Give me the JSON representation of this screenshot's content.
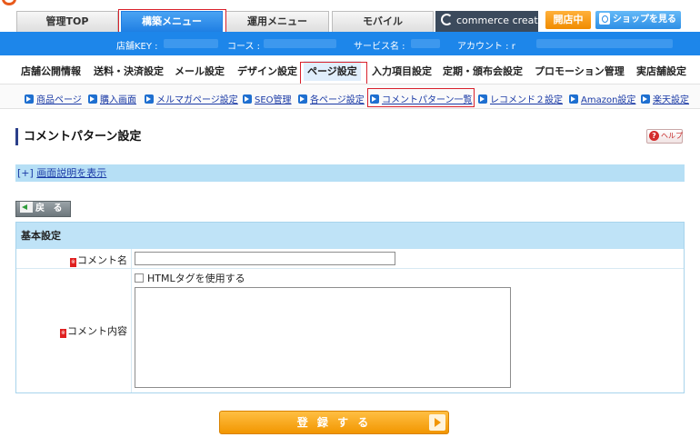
{
  "main_tabs": [
    {
      "label": "管理TOP"
    },
    {
      "label": "構築メニュー"
    },
    {
      "label": "運用メニュー"
    },
    {
      "label": "モバイル"
    }
  ],
  "header_buttons": {
    "commerce_creator": "commerce creator",
    "store_open": "開店中",
    "view_shop": "ショップを見る"
  },
  "info_bar": {
    "store_key_label": "店舗KEY :",
    "course_label": "コース :",
    "service_name_label": "サービス名 :",
    "account_label": "アカウント : r"
  },
  "sub_nav": [
    {
      "label": "店舗公開情報"
    },
    {
      "label": "送料・決済設定"
    },
    {
      "label": "メール設定"
    },
    {
      "label": "デザイン設定"
    },
    {
      "label": "ページ設定"
    },
    {
      "label": "入力項目設定"
    },
    {
      "label": "定期・頒布会設定"
    },
    {
      "label": "プロモーション管理"
    },
    {
      "label": "実店舗設定"
    }
  ],
  "third_nav": [
    {
      "label": "商品ページ"
    },
    {
      "label": "購入画面"
    },
    {
      "label": "メルマガページ設定"
    },
    {
      "label": "SEO管理"
    },
    {
      "label": "各ページ設定"
    },
    {
      "label": "コメントパターン一覧"
    },
    {
      "label": "レコメンド２設定"
    },
    {
      "label": "Amazon設定"
    },
    {
      "label": "楽天設定"
    }
  ],
  "page": {
    "title": "コメントパターン設定",
    "help_label": "ヘルプ",
    "help_q": "?",
    "description_prefix": "[+]",
    "description_link": "画面説明を表示",
    "back_label": "戻 る"
  },
  "form": {
    "section_title": "基本設定",
    "required_mark": "※",
    "comment_name_label": "コメント名",
    "comment_name_value": "",
    "html_tag_checkbox_label": "HTMLタグを使用する",
    "html_tag_checked": false,
    "comment_content_label": "コメント内容",
    "comment_content_value": ""
  },
  "submit": {
    "label": "登 録 す る"
  }
}
